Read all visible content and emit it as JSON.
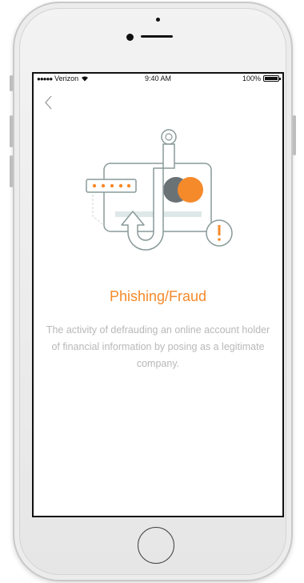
{
  "status_bar": {
    "signal_dots": "●●●●●",
    "carrier": "Verizon",
    "wifi_icon": "wifi-icon",
    "time": "9:40 AM",
    "battery": "100%"
  },
  "nav": {
    "back_icon": "chevron-left-icon"
  },
  "content": {
    "title": "Phishing/Fraud",
    "description": "The activity of defrauding an online account holder of financial information by posing as a legitimate company."
  },
  "colors": {
    "accent": "#f58a2b",
    "text_muted": "#b8b8b8",
    "illustration_stroke": "#8a9a9a",
    "card_dark_circle": "#6b7276"
  }
}
